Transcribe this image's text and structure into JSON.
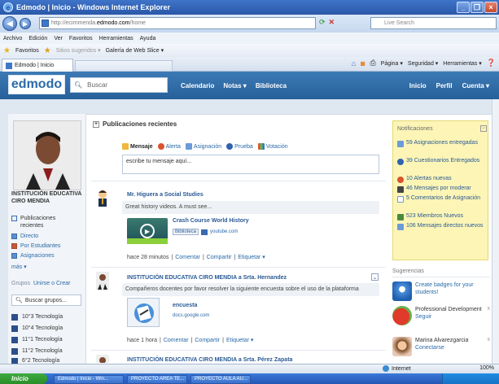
{
  "window": {
    "title": "Edmodo | Inicio - Windows Internet Explorer",
    "url_prefix": "http://ecirnmenda.",
    "url_domain": "edmodo.com",
    "url_path": "/home",
    "live_search_placeholder": "Live Search"
  },
  "menubar": [
    "Archivo",
    "Edición",
    "Ver",
    "Favoritos",
    "Herramientas",
    "Ayuda"
  ],
  "favbar": {
    "favorites": "Favoritos",
    "suggested": "Sitios sugeridos ▾",
    "gallery": "Galería de Web Slice ▾"
  },
  "tab": {
    "label": "Edmodo | Inicio"
  },
  "commandbar": [
    "Página ▾",
    "Seguridad ▾",
    "Herramientas ▾"
  ],
  "edmodo": {
    "logo": "edmodo",
    "search_placeholder": "Buscar",
    "nav": [
      "Calendario",
      "Notas ▾",
      "Biblioteca"
    ],
    "right_nav": [
      "Inicio",
      "Perfil",
      "Cuenta ▾"
    ]
  },
  "profile": {
    "name": "INSTITUCIÓN EDUCATIVA CIRO MENDIA"
  },
  "left_menu": {
    "recent": "Publicaciones recientes",
    "items": [
      "Directo",
      "Por Estudiantes",
      "Asignaciones"
    ],
    "more": "más ▾"
  },
  "groups": {
    "label": "Grupos",
    "join": "Unirse o Crear",
    "search_placeholder": "Buscar grupos...",
    "items": [
      "10°3 Tecnología",
      "10°4 Tecnología",
      "11°1 Tecnología",
      "11°2 Tecnología",
      "6°2 Tecnología"
    ]
  },
  "center": {
    "heading": "Publicaciones recientes",
    "post_types": [
      "Mensaje",
      "Alerta",
      "Asignación",
      "Prueba",
      "Votación"
    ],
    "compose_placeholder": "escribe tu mensaje aquí...",
    "posts": [
      {
        "title": "Mr. Higuera a Social Studies",
        "body": "Great history videos. A must see...",
        "link_title": "Crash Course World History",
        "library": "Biblioteca",
        "source": "youtube.com",
        "time": "hace 28 minutos",
        "actions": [
          "Comentar",
          "Compartir",
          "Etiquetar ▾"
        ]
      },
      {
        "title": "INSTITUCIÓN EDUCATIVA CIRO MENDIA a Srta. Hernandez",
        "body": "Compañeros docentes por favor resolver la siguiente encuesta sobre el uso de la plataforma",
        "link_title": "encuesta",
        "source": "docs.google.com",
        "time": "hace 1 hora",
        "actions": [
          "Comentar",
          "Compartir",
          "Etiquetar ▾"
        ]
      },
      {
        "title": "INSTITUCIÓN EDUCATIVA CIRO MENDIA a Srta. Pérez Zapata"
      }
    ]
  },
  "notifications": {
    "heading": "Notificaciones",
    "items": [
      "59 Asignaciones entregadas",
      "39 Cuestionarios Entregados",
      "10 Alertas nuevas",
      "46 Mensajes por moderar",
      "5 Comentarios de Asignación",
      "523 Miembros Nuevos",
      "106 Mensajes directos nuevos"
    ]
  },
  "suggestions": {
    "heading": "Sugerencias",
    "items": [
      {
        "text": "Create badges for your students!"
      },
      {
        "text": "Professional Development",
        "action": "Seguir"
      },
      {
        "text": "Marina Alvarezgarcia",
        "action": "Conectarse"
      }
    ]
  },
  "statusbar": {
    "zone": "Internet",
    "zoom": "100%"
  },
  "taskbar": {
    "start": "Inicio",
    "items": [
      "Edmodo | Inicio - Win...",
      "PROYECTO AREA TE...",
      "PROYECTO AULA AU..."
    ]
  },
  "colors": {
    "edmodo_blue": "#2e6aa6",
    "notification_bg": "#fcf5b6"
  }
}
